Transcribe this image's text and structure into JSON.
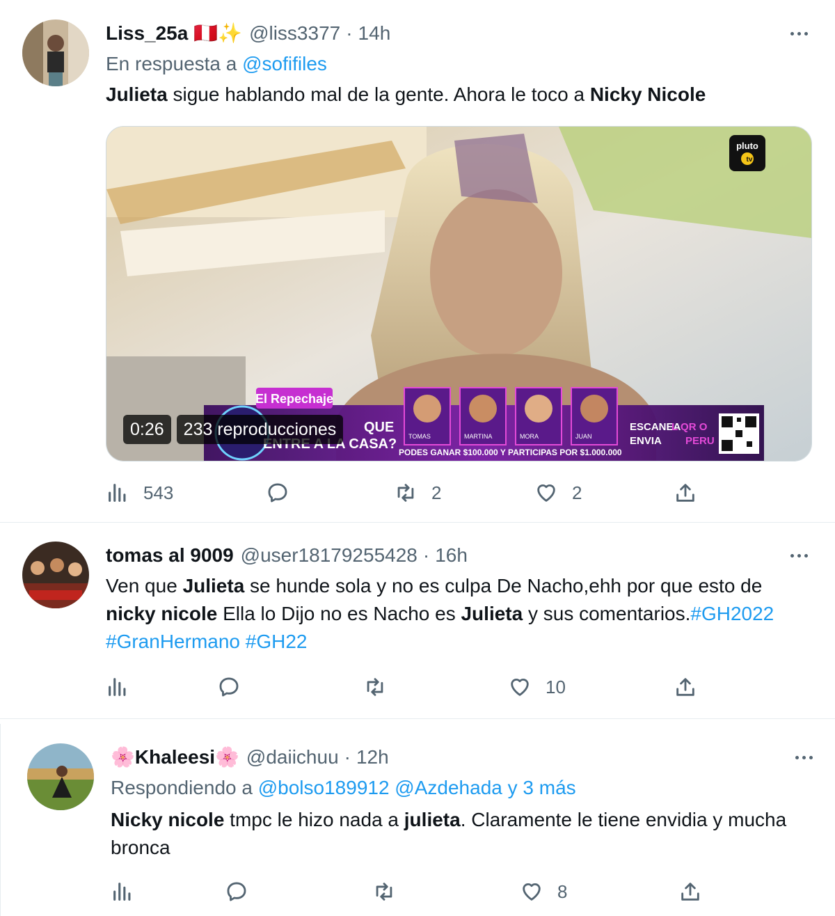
{
  "tweets": [
    {
      "name": "Liss_25a",
      "emoji": "🇵🇪✨",
      "handle": "@liss3377",
      "time": "14h",
      "reply_prefix": "En respuesta a",
      "reply_mentions": "@sofifiles",
      "text": [
        {
          "t": "Julieta",
          "b": true
        },
        {
          "t": " sigue hablando mal de la gente. Ahora le toco a "
        },
        {
          "t": "Nicky Nicole",
          "b": true
        }
      ],
      "video": {
        "duration": "0:26",
        "views": "233 reproducciones",
        "overlay": {
          "badge": "El Repechaje",
          "question_end": "QUE",
          "question_line2": "ENTRE A LA CASA?",
          "names": [
            "TOMAS",
            "MARTINA",
            "MORA",
            "JUAN"
          ],
          "footer": "PODES GANAR $100.000 Y PARTICIPAS POR $1.000.000",
          "scan_line1": "ESCANEA",
          "scan_line1b": "L QR O",
          "scan_line2": "ENVIA",
          "scan_line2b": "PERU",
          "logo_line1": "pluto",
          "logo_line2": "tv"
        }
      },
      "stats": {
        "views": "543",
        "replies": "",
        "retweets": "2",
        "likes": "2"
      }
    },
    {
      "name": "tomas al 9009",
      "handle": "@user18179255428",
      "time": "16h",
      "text": [
        {
          "t": "Ven que "
        },
        {
          "t": "Julieta",
          "b": true
        },
        {
          "t": " se hunde sola y no es culpa De Nacho,ehh por que esto de "
        },
        {
          "t": "nicky nicole",
          "b": true
        },
        {
          "t": " Ella lo Dijo no es Nacho es "
        },
        {
          "t": "Julieta",
          "b": true
        },
        {
          "t": " y sus comentarios."
        },
        {
          "t": "#GH2022 #GranHermano #GH22",
          "h": true
        }
      ],
      "stats": {
        "views": "",
        "replies": "",
        "retweets": "",
        "likes": "10"
      }
    },
    {
      "name_prefix": "🌸",
      "name": "Khaleesi",
      "name_suffix": "🌸",
      "handle": "@daiichuu",
      "time": "12h",
      "reply_prefix": "Respondiendo a",
      "reply_mentions": "@bolso189912 @Azdehada y 3 más",
      "text": [
        {
          "t": "Nicky nicole",
          "b": true
        },
        {
          "t": " tmpc le hizo nada a "
        },
        {
          "t": "julieta",
          "b": true
        },
        {
          "t": ". Claramente le tiene envidia y mucha bronca"
        }
      ],
      "stats": {
        "views": "",
        "replies": "",
        "retweets": "",
        "likes": "8"
      }
    }
  ],
  "colors": {
    "text": "#0f1419",
    "secondary": "#536471",
    "link": "#1d9bf0",
    "divider": "#e6ecf0"
  },
  "icons": [
    "analytics-icon",
    "reply-icon",
    "retweet-icon",
    "like-icon",
    "share-icon",
    "more-icon"
  ]
}
